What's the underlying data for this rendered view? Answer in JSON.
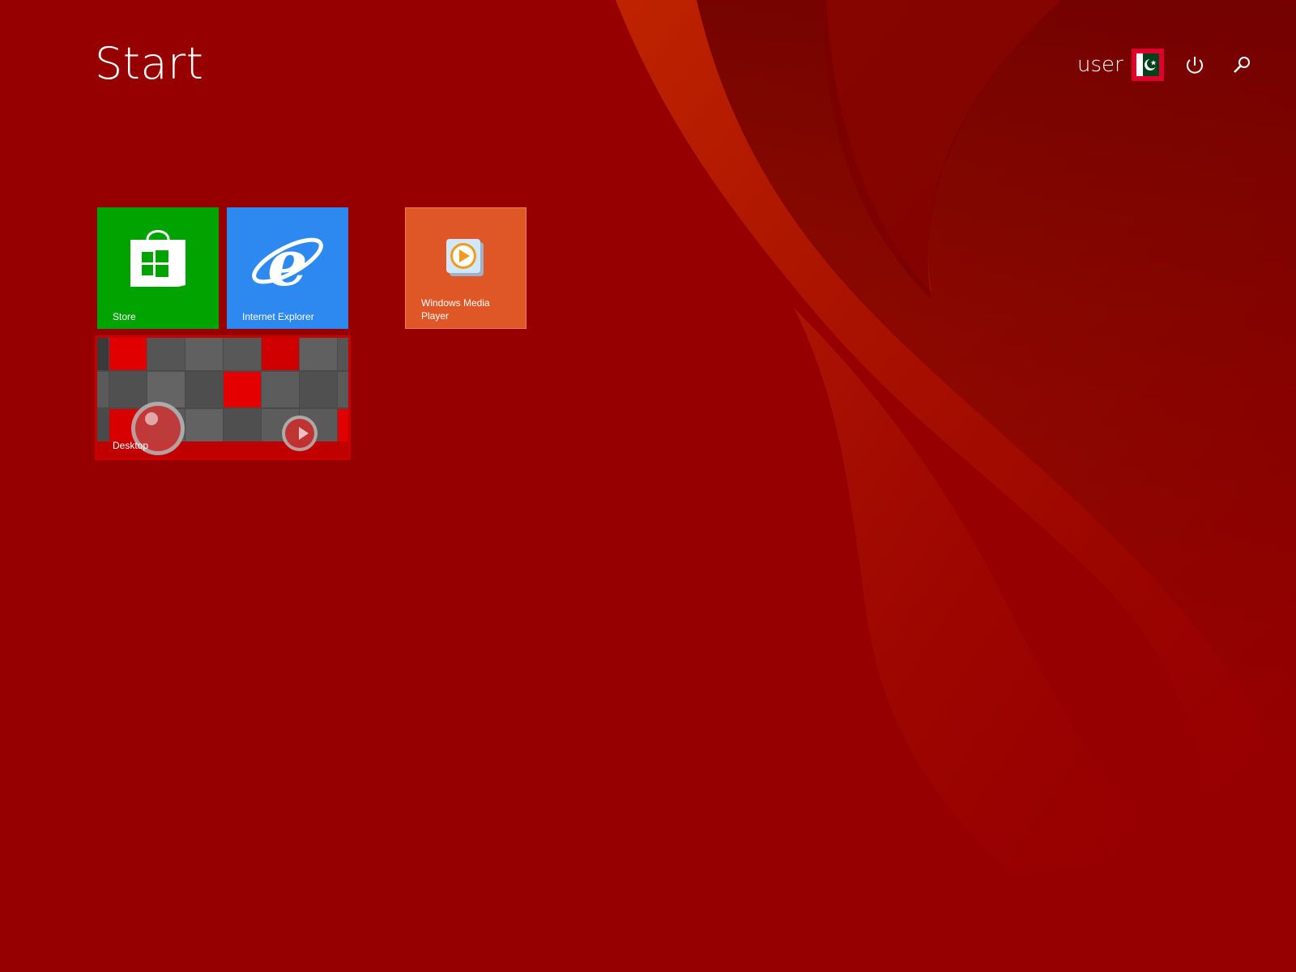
{
  "start": {
    "title": "Start"
  },
  "user": {
    "name": "user"
  },
  "header_icons": {
    "power": "power-icon",
    "search": "search-icon"
  },
  "tiles": [
    {
      "label": "Store",
      "icon": "store-bag-icon",
      "color": "#00a300"
    },
    {
      "label": "Internet Explorer",
      "icon": "internet-explorer-icon",
      "color": "#2d89ef"
    },
    {
      "label": "Windows Media Player",
      "icon": "media-player-icon",
      "color": "#e05727"
    },
    {
      "label": "Desktop",
      "icon": "desktop-wallpaper-preview",
      "color": "#5a5a5a"
    }
  ],
  "theme": {
    "background": "#970000",
    "accent": "#e1002b"
  }
}
